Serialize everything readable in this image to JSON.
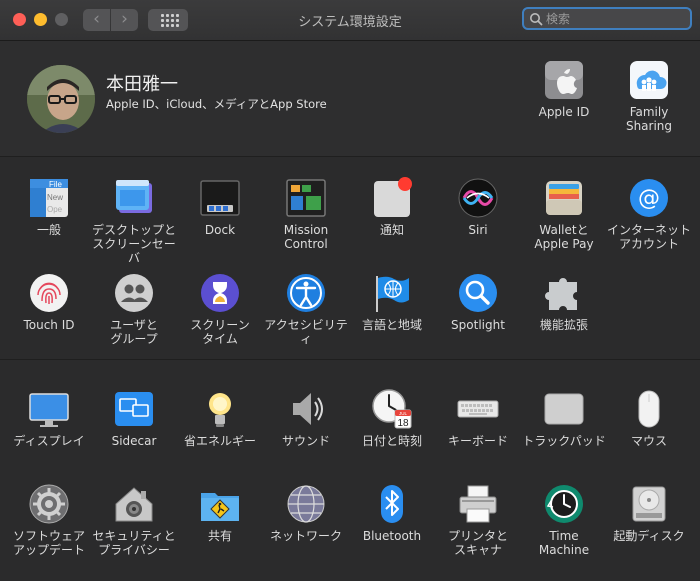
{
  "window": {
    "title": "システム環境設定"
  },
  "search": {
    "placeholder": "検索"
  },
  "account": {
    "name": "本田雅一",
    "subtitle": "Apple ID、iCloud、メディアとApp Store",
    "items": [
      {
        "label": "Apple ID",
        "icon": "apple-icon"
      },
      {
        "label": "Family\nSharing",
        "icon": "family-sharing-icon"
      }
    ]
  },
  "row1": [
    {
      "label": "一般",
      "icon": "general-icon",
      "file_lines": [
        "File",
        "New",
        "Ope"
      ]
    },
    {
      "label": "デスクトップと\nスクリーンセーバ",
      "icon": "desktop-icon"
    },
    {
      "label": "Dock",
      "icon": "dock-icon"
    },
    {
      "label": "Mission\nControl",
      "icon": "mission-control-icon"
    },
    {
      "label": "通知",
      "icon": "notifications-icon"
    },
    {
      "label": "Siri",
      "icon": "siri-icon"
    },
    {
      "label": "Walletと\nApple Pay",
      "icon": "wallet-icon"
    },
    {
      "label": "インターネット\nアカウント",
      "icon": "internet-accounts-icon"
    }
  ],
  "row2": [
    {
      "label": "Touch ID",
      "icon": "touch-id-icon"
    },
    {
      "label": "ユーザと\nグループ",
      "icon": "users-icon"
    },
    {
      "label": "スクリーン\nタイム",
      "icon": "screen-time-icon"
    },
    {
      "label": "アクセシビリティ",
      "icon": "accessibility-icon"
    },
    {
      "label": "言語と地域",
      "icon": "language-region-icon"
    },
    {
      "label": "Spotlight",
      "icon": "spotlight-icon"
    },
    {
      "label": "機能拡張",
      "icon": "extensions-icon"
    }
  ],
  "row3": [
    {
      "label": "ディスプレイ",
      "icon": "display-icon"
    },
    {
      "label": "Sidecar",
      "icon": "sidecar-icon"
    },
    {
      "label": "省エネルギー",
      "icon": "energy-saver-icon"
    },
    {
      "label": "サウンド",
      "icon": "sound-icon"
    },
    {
      "label": "日付と時刻",
      "icon": "date-time-icon",
      "calendar": {
        "month": "JUL",
        "day": "18"
      }
    },
    {
      "label": "キーボード",
      "icon": "keyboard-icon"
    },
    {
      "label": "トラックパッド",
      "icon": "trackpad-icon"
    },
    {
      "label": "マウス",
      "icon": "mouse-icon"
    }
  ],
  "row4": [
    {
      "label": "ソフトウェア\nアップデート",
      "icon": "software-update-icon"
    },
    {
      "label": "セキュリティと\nプライバシー",
      "icon": "security-icon"
    },
    {
      "label": "共有",
      "icon": "sharing-icon"
    },
    {
      "label": "ネットワーク",
      "icon": "network-icon"
    },
    {
      "label": "Bluetooth",
      "icon": "bluetooth-icon"
    },
    {
      "label": "プリンタと\nスキャナ",
      "icon": "printers-icon"
    },
    {
      "label": "Time\nMachine",
      "icon": "time-machine-icon"
    },
    {
      "label": "起動ディスク",
      "icon": "startup-disk-icon"
    }
  ],
  "colors": {
    "accent": "#3f7fbf",
    "close": "#fe5f57",
    "minimize": "#febc2e"
  }
}
